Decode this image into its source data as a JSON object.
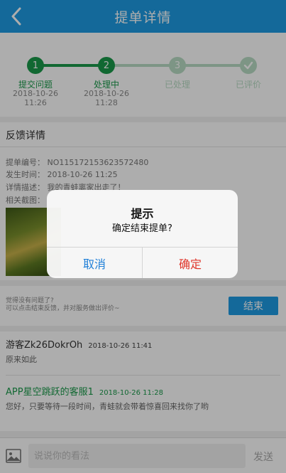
{
  "header": {
    "title": "提单详情"
  },
  "progress": {
    "steps": [
      {
        "num": "1",
        "label": "提交问题",
        "date": "2018-10-26",
        "time": "11:26"
      },
      {
        "num": "2",
        "label": "处理中",
        "date": "2018-10-26",
        "time": "11:28"
      },
      {
        "num": "3",
        "label": "已处理"
      },
      {
        "num": "✓",
        "label": "已评价"
      }
    ]
  },
  "feedback": {
    "title": "反馈详情",
    "ticket": "提单编号： NO115172153623572480",
    "time": "发生时间： 2018-10-26 11:25",
    "desc": "详情描述： 我的青蛙离家出走了！",
    "screenshot_label": "相关截图："
  },
  "endbar": {
    "hint1": "觉得没有问题了?",
    "hint2": "可以点击结束反馈，并对服务做出评价~",
    "end_label": "结束"
  },
  "comments": [
    {
      "name": "游客Zk26DokrOh",
      "time": "2018-10-26 11:41",
      "body": "原来如此"
    },
    {
      "name": "APP星空跳跃的客服1",
      "time": "2018-10-26 11:28",
      "body": "您好，只要等待一段时间，青蛙就会带着惊喜回来找你了哟"
    }
  ],
  "bottombar": {
    "placeholder": "说说你的看法",
    "send_label": "发送"
  },
  "dialog": {
    "title": "提示",
    "message": "确定结束提单?",
    "cancel": "取消",
    "confirm": "确定"
  },
  "colors": {
    "brand": "#1e9be4",
    "step_done": "#1a9a4a",
    "step_todo": "#b8dcc4",
    "agent_name": "#1a9a4a",
    "confirm": "#e0362b",
    "cancel": "#1e7fd8"
  },
  "icons": {
    "back": "chevron-left-icon",
    "image": "image-icon",
    "check": "check-icon"
  }
}
